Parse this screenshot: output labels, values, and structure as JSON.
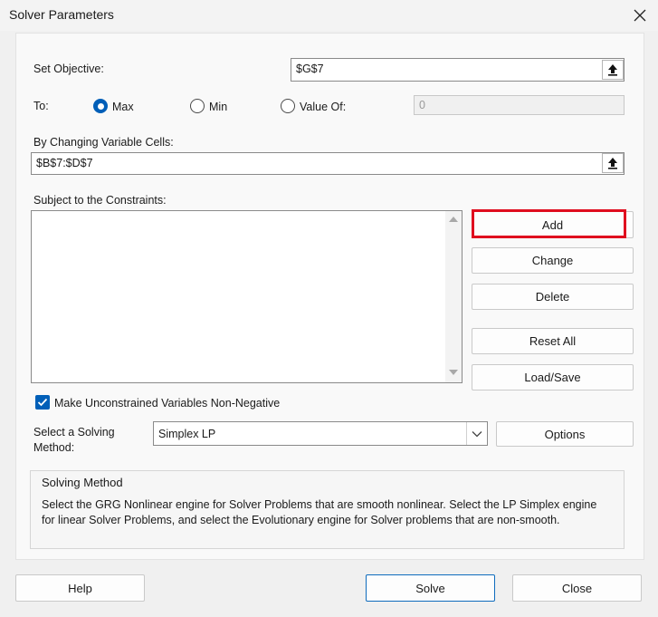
{
  "window": {
    "title": "Solver Parameters"
  },
  "objective": {
    "label": "Set Objective:",
    "value": "$G$7"
  },
  "to": {
    "label": "To:",
    "options": [
      {
        "label": "Max",
        "selected": true
      },
      {
        "label": "Min",
        "selected": false
      },
      {
        "label": "Value Of:",
        "selected": false
      }
    ],
    "value_of": "0"
  },
  "variables": {
    "label": "By Changing Variable Cells:",
    "value": "$B$7:$D$7"
  },
  "constraints": {
    "label": "Subject to the Constraints:",
    "items": []
  },
  "side_buttons": {
    "add": "Add",
    "change": "Change",
    "delete": "Delete",
    "reset_all": "Reset All",
    "load_save": "Load/Save"
  },
  "nonneg": {
    "label": "Make Unconstrained Variables Non-Negative",
    "checked": true
  },
  "method": {
    "label_line1": "Select a Solving",
    "label_line2": "Method:",
    "selected": "Simplex LP",
    "options_button": "Options"
  },
  "solving_method": {
    "title": "Solving Method",
    "description": "Select the GRG Nonlinear engine for Solver Problems that are smooth nonlinear. Select the LP Simplex engine for linear Solver Problems, and select the Evolutionary engine for Solver problems that are non-smooth."
  },
  "footer": {
    "help": "Help",
    "solve": "Solve",
    "close": "Close"
  },
  "colors": {
    "accent": "#005fb8",
    "highlight": "#e00d1f"
  }
}
